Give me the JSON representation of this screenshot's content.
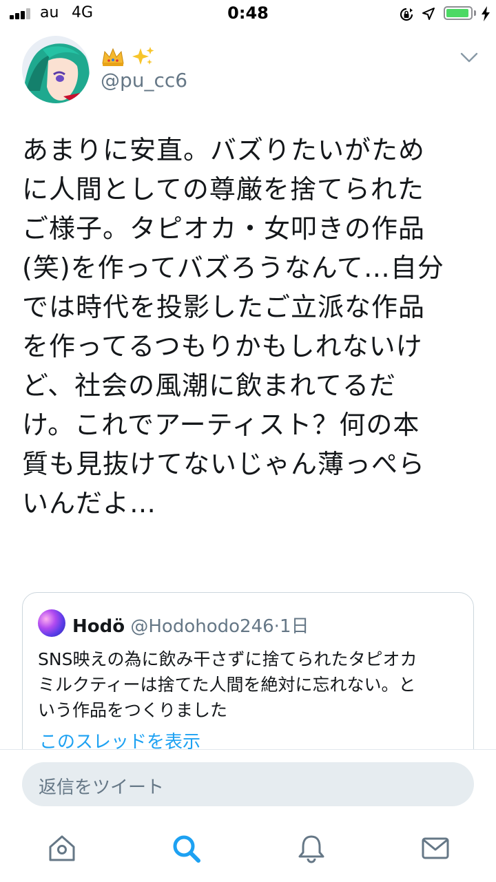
{
  "status_bar": {
    "carrier": "au",
    "network": "4G",
    "time": "0:48",
    "battery_level": 0.95,
    "colors": {
      "battery": "#4cd964"
    }
  },
  "tweet": {
    "name_emoji": "👑✨",
    "handle": "@pu_cc6",
    "avatar": "anime-character-avatar",
    "text": "あまりに安直。バズりたいがため\nに人間としての尊厳を捨てられた\nご様子。タピオカ・女叩きの作品\n(笑)を作ってバズろうなんて…自分\nでは時代を投影したご立派な作品\nを作ってるつもりかもしれないけ\nど、社会の風潮に飲まれてるだ\nけ。これでアーティスト？何の本\n質も見抜けてないじゃん薄っぺら\nいんだよ…"
  },
  "quote": {
    "name": "Hodö",
    "handle": "@Hodohodo246",
    "separator": "·",
    "time": "1日",
    "text": "SNS映えの為に飲み干さずに捨てられたタピオカ\nミルクティーは捨てた人間を絶対に忘れない。と\nいう作品をつくりました",
    "thread_link": "このスレッドを表示"
  },
  "reply": {
    "placeholder": "返信をツイート"
  },
  "tabs": [
    "home-icon",
    "search-icon",
    "notifications-icon",
    "messages-icon"
  ],
  "colors": {
    "accent": "#1da1f2",
    "muted": "#657786",
    "text": "#14171a"
  }
}
